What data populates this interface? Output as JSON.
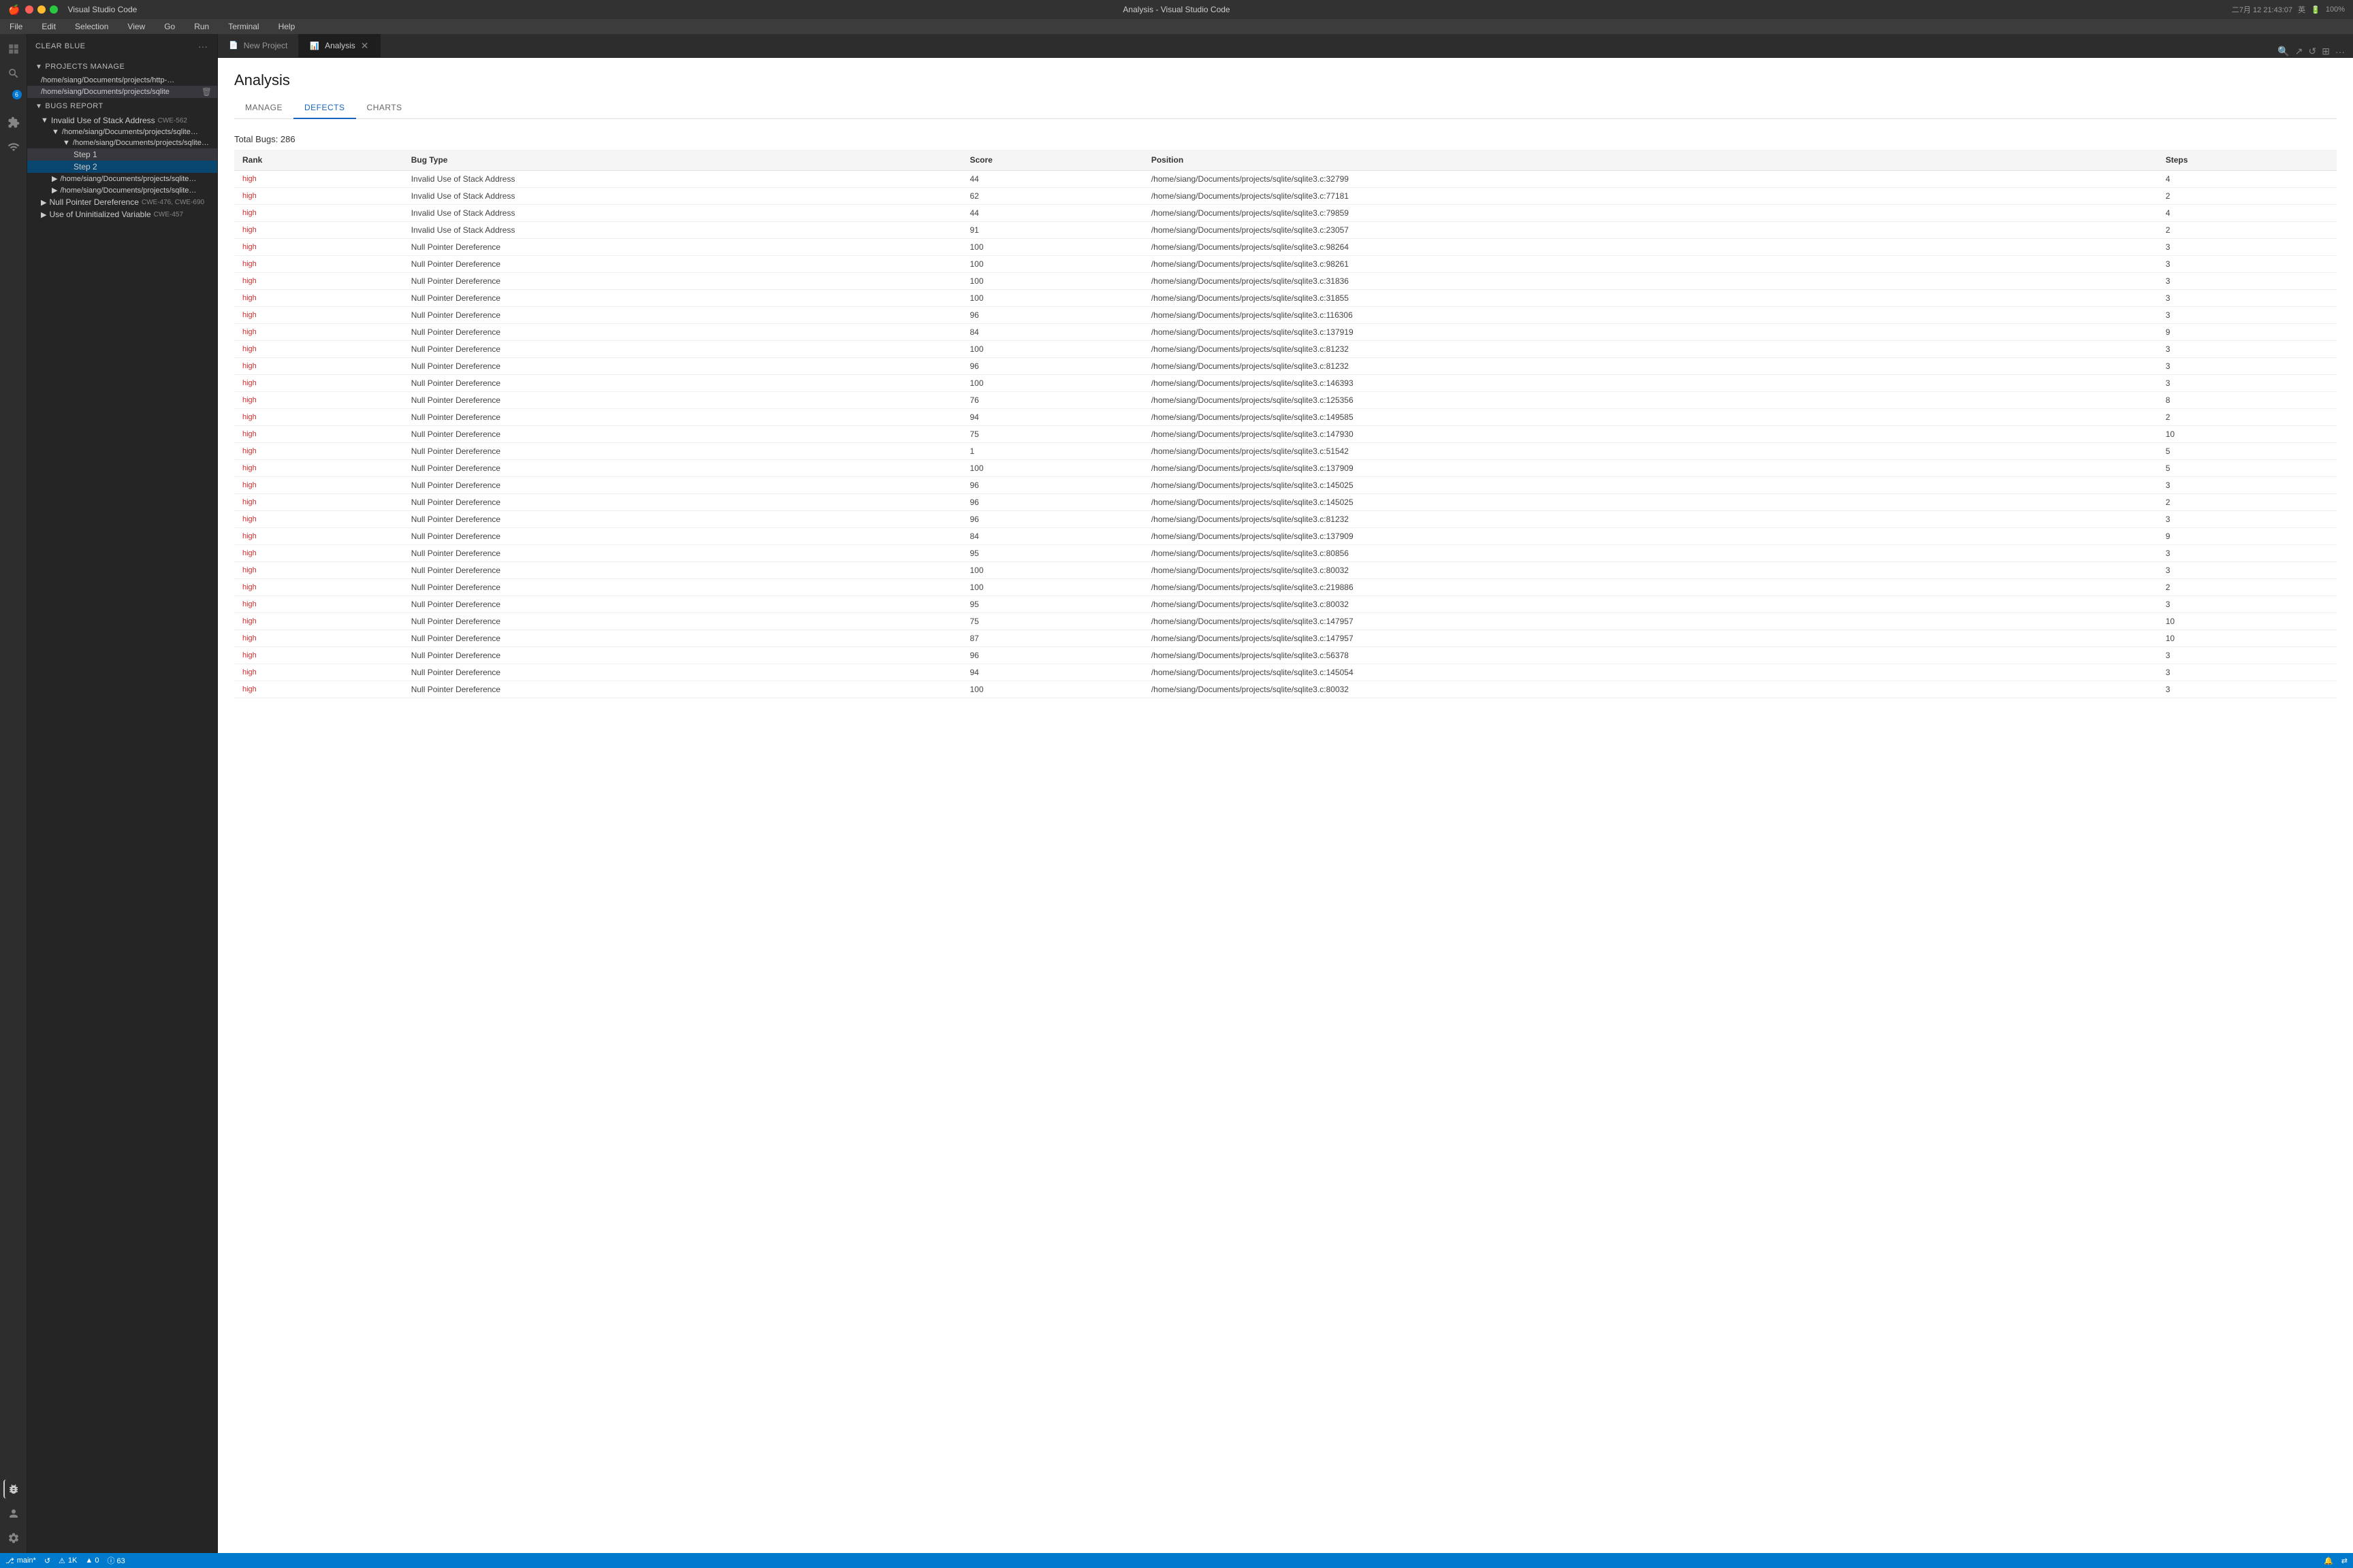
{
  "window": {
    "title": "Analysis - Visual Studio Code",
    "app_name": "Visual Studio Code"
  },
  "title_bar": {
    "time": "二7月 12  21:43:07",
    "battery": "100%",
    "wifi_icon": "wifi",
    "sound_icon": "🔊",
    "input_method": "英"
  },
  "menu": {
    "items": [
      "File",
      "Edit",
      "Selection",
      "View",
      "Go",
      "Run",
      "Terminal",
      "Help"
    ]
  },
  "sidebar": {
    "header_label": "CLEAR BLUE",
    "projects_section": "PROJECTS MANAGE",
    "projects": [
      "/home/siang/Documents/projects/http-par...",
      "/home/siang/Documents/projects/sqlite"
    ],
    "bugs_section": "BUGS REPORT",
    "bug_categories": [
      {
        "name": "Invalid Use of Stack Address",
        "cwe": "CWE-562",
        "expanded": true,
        "children": [
          {
            "path": "/home/siang/Documents/projects/sqlite/s...",
            "expanded": true,
            "children": [
              {
                "path": "/home/siang/Documents/projects/sqlite/s...",
                "expanded": true,
                "children": [
                  "Step 1",
                  "Step 2"
                ]
              }
            ]
          },
          {
            "path": "/home/siang/Documents/projects/sqlite/s...",
            "expanded": false
          },
          {
            "path": "/home/siang/Documents/projects/sqlite/s...",
            "expanded": false
          }
        ]
      },
      {
        "name": "Null Pointer Dereference",
        "cwe": "CWE-476, CWE-690",
        "expanded": false
      },
      {
        "name": "Use of Uninitialized Variable",
        "cwe": "CWE-457",
        "expanded": false
      }
    ]
  },
  "tabs": [
    {
      "label": "New Project",
      "active": false,
      "closable": false,
      "icon": "📄"
    },
    {
      "label": "Analysis",
      "active": true,
      "closable": true,
      "icon": "📊"
    }
  ],
  "analysis": {
    "title": "Analysis",
    "tabs": [
      "MANAGE",
      "DEFECTS",
      "CHARTS"
    ],
    "active_tab": "DEFECTS",
    "total_bugs": "Total Bugs: 286",
    "table": {
      "columns": [
        "Rank",
        "Bug Type",
        "Score",
        "Position",
        "Steps"
      ],
      "rows": [
        {
          "rank": "high",
          "bug_type": "Invalid Use of Stack Address",
          "score": "44",
          "position": "/home/siang/Documents/projects/sqlite/sqlite3.c:32799",
          "steps": "4"
        },
        {
          "rank": "high",
          "bug_type": "Invalid Use of Stack Address",
          "score": "62",
          "position": "/home/siang/Documents/projects/sqlite/sqlite3.c:77181",
          "steps": "2"
        },
        {
          "rank": "high",
          "bug_type": "Invalid Use of Stack Address",
          "score": "44",
          "position": "/home/siang/Documents/projects/sqlite/sqlite3.c:79859",
          "steps": "4"
        },
        {
          "rank": "high",
          "bug_type": "Invalid Use of Stack Address",
          "score": "91",
          "position": "/home/siang/Documents/projects/sqlite/sqlite3.c:23057",
          "steps": "2"
        },
        {
          "rank": "high",
          "bug_type": "Null Pointer Dereference",
          "score": "100",
          "position": "/home/siang/Documents/projects/sqlite/sqlite3.c:98264",
          "steps": "3"
        },
        {
          "rank": "high",
          "bug_type": "Null Pointer Dereference",
          "score": "100",
          "position": "/home/siang/Documents/projects/sqlite/sqlite3.c:98261",
          "steps": "3"
        },
        {
          "rank": "high",
          "bug_type": "Null Pointer Dereference",
          "score": "100",
          "position": "/home/siang/Documents/projects/sqlite/sqlite3.c:31836",
          "steps": "3"
        },
        {
          "rank": "high",
          "bug_type": "Null Pointer Dereference",
          "score": "100",
          "position": "/home/siang/Documents/projects/sqlite/sqlite3.c:31855",
          "steps": "3"
        },
        {
          "rank": "high",
          "bug_type": "Null Pointer Dereference",
          "score": "96",
          "position": "/home/siang/Documents/projects/sqlite/sqlite3.c:116306",
          "steps": "3"
        },
        {
          "rank": "high",
          "bug_type": "Null Pointer Dereference",
          "score": "84",
          "position": "/home/siang/Documents/projects/sqlite/sqlite3.c:137919",
          "steps": "9"
        },
        {
          "rank": "high",
          "bug_type": "Null Pointer Dereference",
          "score": "100",
          "position": "/home/siang/Documents/projects/sqlite/sqlite3.c:81232",
          "steps": "3"
        },
        {
          "rank": "high",
          "bug_type": "Null Pointer Dereference",
          "score": "96",
          "position": "/home/siang/Documents/projects/sqlite/sqlite3.c:81232",
          "steps": "3"
        },
        {
          "rank": "high",
          "bug_type": "Null Pointer Dereference",
          "score": "100",
          "position": "/home/siang/Documents/projects/sqlite/sqlite3.c:146393",
          "steps": "3"
        },
        {
          "rank": "high",
          "bug_type": "Null Pointer Dereference",
          "score": "76",
          "position": "/home/siang/Documents/projects/sqlite/sqlite3.c:125356",
          "steps": "8"
        },
        {
          "rank": "high",
          "bug_type": "Null Pointer Dereference",
          "score": "94",
          "position": "/home/siang/Documents/projects/sqlite/sqlite3.c:149585",
          "steps": "2"
        },
        {
          "rank": "high",
          "bug_type": "Null Pointer Dereference",
          "score": "75",
          "position": "/home/siang/Documents/projects/sqlite/sqlite3.c:147930",
          "steps": "10"
        },
        {
          "rank": "high",
          "bug_type": "Null Pointer Dereference",
          "score": "1",
          "position": "/home/siang/Documents/projects/sqlite/sqlite3.c:51542",
          "steps": "5"
        },
        {
          "rank": "high",
          "bug_type": "Null Pointer Dereference",
          "score": "100",
          "position": "/home/siang/Documents/projects/sqlite/sqlite3.c:137909",
          "steps": "5"
        },
        {
          "rank": "high",
          "bug_type": "Null Pointer Dereference",
          "score": "96",
          "position": "/home/siang/Documents/projects/sqlite/sqlite3.c:145025",
          "steps": "3"
        },
        {
          "rank": "high",
          "bug_type": "Null Pointer Dereference",
          "score": "96",
          "position": "/home/siang/Documents/projects/sqlite/sqlite3.c:145025",
          "steps": "2"
        },
        {
          "rank": "high",
          "bug_type": "Null Pointer Dereference",
          "score": "96",
          "position": "/home/siang/Documents/projects/sqlite/sqlite3.c:81232",
          "steps": "3"
        },
        {
          "rank": "high",
          "bug_type": "Null Pointer Dereference",
          "score": "84",
          "position": "/home/siang/Documents/projects/sqlite/sqlite3.c:137909",
          "steps": "9"
        },
        {
          "rank": "high",
          "bug_type": "Null Pointer Dereference",
          "score": "95",
          "position": "/home/siang/Documents/projects/sqlite/sqlite3.c:80856",
          "steps": "3"
        },
        {
          "rank": "high",
          "bug_type": "Null Pointer Dereference",
          "score": "100",
          "position": "/home/siang/Documents/projects/sqlite/sqlite3.c:80032",
          "steps": "3"
        },
        {
          "rank": "high",
          "bug_type": "Null Pointer Dereference",
          "score": "100",
          "position": "/home/siang/Documents/projects/sqlite/sqlite3.c:219886",
          "steps": "2"
        },
        {
          "rank": "high",
          "bug_type": "Null Pointer Dereference",
          "score": "95",
          "position": "/home/siang/Documents/projects/sqlite/sqlite3.c:80032",
          "steps": "3"
        },
        {
          "rank": "high",
          "bug_type": "Null Pointer Dereference",
          "score": "75",
          "position": "/home/siang/Documents/projects/sqlite/sqlite3.c:147957",
          "steps": "10"
        },
        {
          "rank": "high",
          "bug_type": "Null Pointer Dereference",
          "score": "87",
          "position": "/home/siang/Documents/projects/sqlite/sqlite3.c:147957",
          "steps": "10"
        },
        {
          "rank": "high",
          "bug_type": "Null Pointer Dereference",
          "score": "96",
          "position": "/home/siang/Documents/projects/sqlite/sqlite3.c:56378",
          "steps": "3"
        },
        {
          "rank": "high",
          "bug_type": "Null Pointer Dereference",
          "score": "94",
          "position": "/home/siang/Documents/projects/sqlite/sqlite3.c:145054",
          "steps": "3"
        },
        {
          "rank": "high",
          "bug_type": "Null Pointer Dereference",
          "score": "100",
          "position": "/home/siang/Documents/projects/sqlite/sqlite3.c:80032",
          "steps": "3"
        }
      ]
    }
  },
  "status_bar": {
    "branch": "main*",
    "sync": "↺",
    "errors": "1K",
    "warnings": "▲ 0",
    "info": "ⓘ 63",
    "port": "🔔",
    "remote": "⇄"
  }
}
